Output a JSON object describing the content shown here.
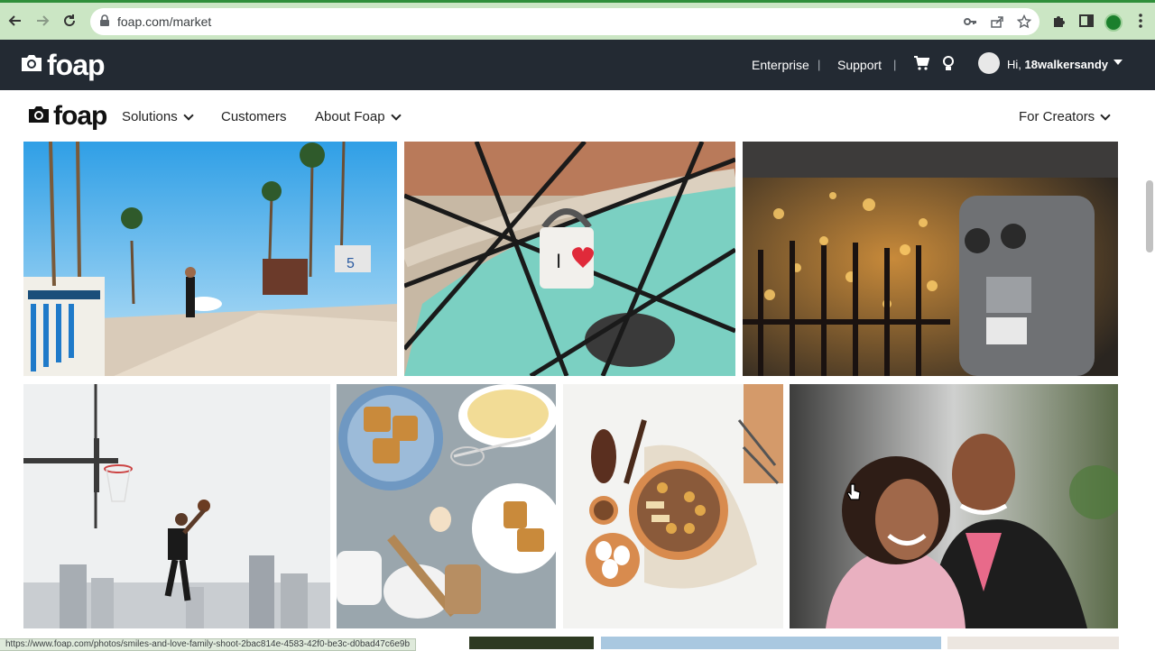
{
  "browser": {
    "url": "foap.com/market",
    "status_url": "https://www.foap.com/photos/smiles-and-love-family-shoot-2bac814e-4583-42f0-be3c-d0bad47c6e9b"
  },
  "topbar": {
    "logo_text": "foap",
    "enterprise_label": "Enterprise",
    "support_label": "Support",
    "separator": "|",
    "greeting_prefix": "Hi,",
    "username": "18walkersandy"
  },
  "subnav": {
    "logo_text": "foap",
    "items": [
      {
        "label": "Solutions"
      },
      {
        "label": "Customers"
      },
      {
        "label": "About Foap"
      }
    ],
    "right_item": "For Creators"
  },
  "colors": {
    "topbar_bg": "#232a33",
    "chrome_bg": "#cbe6c4",
    "accent_green": "#2f8f3a"
  },
  "icons": [
    "back-icon",
    "forward-icon",
    "reload-icon",
    "lock-icon",
    "key-icon",
    "share-icon",
    "star-icon",
    "puzzle-icon",
    "sidepanel-icon",
    "camera-icon",
    "cart-icon",
    "bulb-icon",
    "chevron-down-icon"
  ]
}
